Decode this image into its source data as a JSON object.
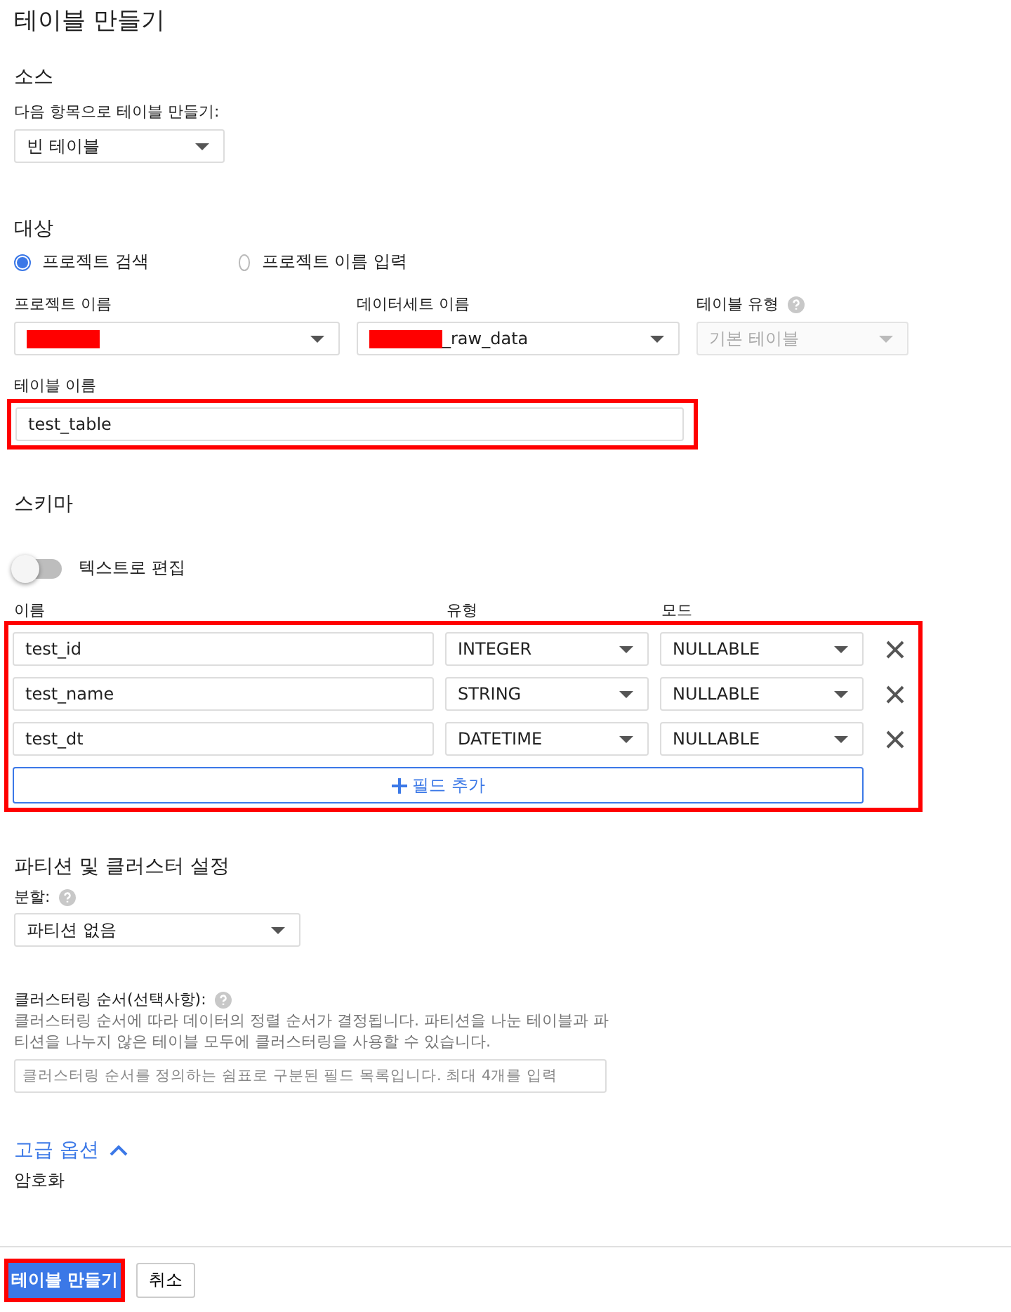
{
  "title": "테이블 만들기",
  "source": {
    "heading": "소스",
    "label": "다음 항목으로 테이블 만들기:",
    "select": "빈 테이블"
  },
  "destination": {
    "heading": "대상",
    "radios": [
      {
        "label": "프로젝트 검색",
        "selected": true
      },
      {
        "label": "프로젝트 이름 입력",
        "selected": false
      }
    ],
    "project": {
      "label": "프로젝트 이름",
      "redacted": true
    },
    "dataset": {
      "label": "데이터세트 이름",
      "value": "_raw_data",
      "redacted": true
    },
    "table_type": {
      "label": "테이블 유형",
      "value": "기본 테이블",
      "disabled": true
    },
    "table_name": {
      "label": "테이블 이름",
      "value": "test_table",
      "highlighted": true
    }
  },
  "schema": {
    "heading": "스키마",
    "toggle": {
      "label": "텍스트로 편집",
      "on": false
    },
    "columns": [
      "이름",
      "유형",
      "모드"
    ],
    "highlighted": true,
    "fields": [
      {
        "name": "test_id",
        "type": "INTEGER",
        "mode": "NULLABLE"
      },
      {
        "name": "test_name",
        "type": "STRING",
        "mode": "NULLABLE"
      },
      {
        "name": "test_dt",
        "type": "DATETIME",
        "mode": "NULLABLE"
      }
    ],
    "add_button": "필드 추가"
  },
  "partition": {
    "heading": "파티션 및 클러스터 설정",
    "label": "분할:",
    "select": "파티션 없음",
    "cluster_label": "클러스터링 순서(선택사항):",
    "cluster_help": "클러스터링 순서에 따라 데이터의 정렬 순서가 결정됩니다. 파티션을 나눈 테이블과 파티션을 나누지 않은 테이블 모두에 클러스터링을 사용할 수 있습니다.",
    "cluster_placeholder": "클러스터링 순서를 정의하는 쉼표로 구분된 필드 목록입니다. 최대 4개를 입력"
  },
  "advanced": {
    "label": "고급 옵션",
    "expanded": true,
    "encryption": "암호화"
  },
  "footer": {
    "create": {
      "label": "테이블 만들기",
      "highlighted": true
    },
    "cancel": "취소"
  }
}
